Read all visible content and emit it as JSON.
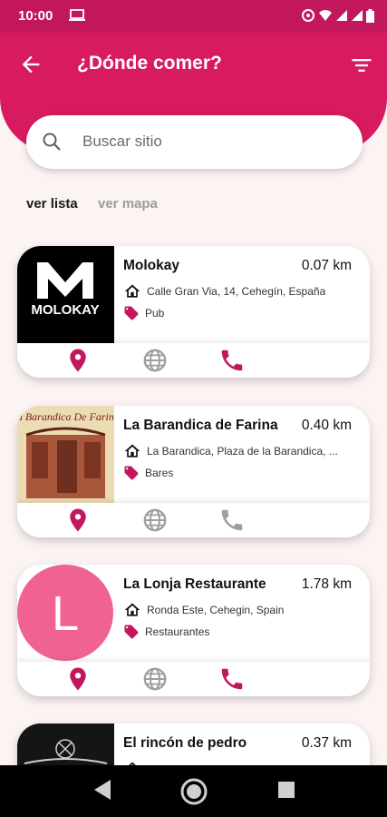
{
  "status_bar": {
    "time": "10:00"
  },
  "header": {
    "title": "¿Dónde comer?"
  },
  "search": {
    "placeholder": "Buscar sitio"
  },
  "view_toggle": {
    "list_label": "ver lista",
    "map_label": "ver mapa"
  },
  "colors": {
    "primary": "#d81b60",
    "accent_icon": "#c2185b",
    "disabled_icon": "#9e9e9e"
  },
  "places": [
    {
      "name": "Molokay",
      "distance": "0.07 km",
      "address": "Calle Gran Via, 14, Cehegín, España",
      "category": "Pub",
      "logo_text": "MOLOKAY",
      "phone_available": true
    },
    {
      "name": "La Barandica de Farina",
      "distance": "0.40 km",
      "address": "La Barandica, Plaza de la Barandica, ...",
      "category": "Bares",
      "logo_text": "La Barandica De Farina",
      "phone_available": false
    },
    {
      "name": "La Lonja Restaurante",
      "distance": "1.78 km",
      "address": "Ronda Este, Cehegin, Spain",
      "category": "Restaurantes",
      "logo_text": "L",
      "phone_available": true
    },
    {
      "name": "El rincón de pedro",
      "distance": "0.37 km",
      "address": "",
      "category": "",
      "logo_text": "",
      "phone_available": true
    }
  ]
}
